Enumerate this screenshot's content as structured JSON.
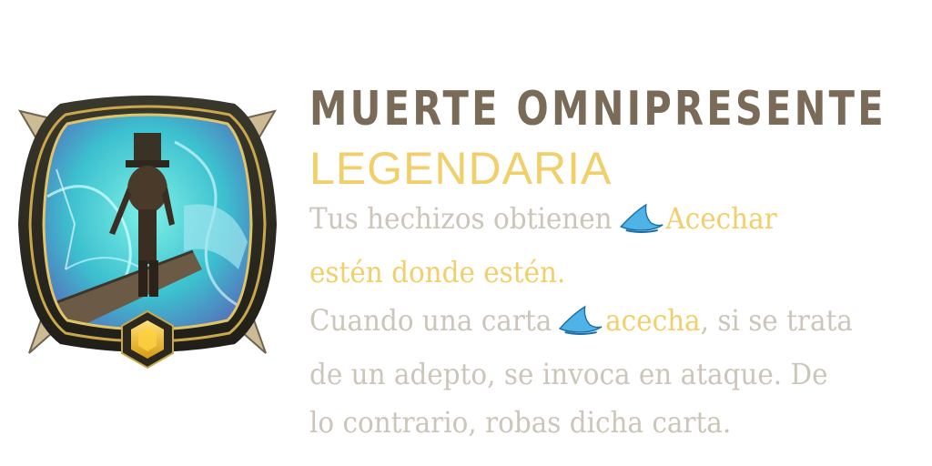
{
  "card": {
    "title": "MUERTE OMNIPRESENTE",
    "rarity": "LEGENDARIA",
    "description": {
      "line1_pre": "Tus hechizos obtienen",
      "line1_kw": "Acechar",
      "line2": "estén donde estén.",
      "line3_pre": "Cuando una carta",
      "line3_kw": "acecha",
      "line3_post": ", si se trata",
      "line4": "de un adepto, se invoca en ataque. De",
      "line5": "lo contrario, robas dicha carta."
    },
    "keyword_icon": "lurk-fin-icon",
    "rarity_gem_icon": "legendary-hexagon-gem-icon",
    "colors": {
      "title": "#7a6b58",
      "rarity": "#f1cf6a",
      "description": "#ccc5b9",
      "keyword": "#f1cf6a",
      "keyword_icon": "#4fb3e6",
      "frame": "#2c2b22",
      "frame_gold": "#c9a74a",
      "art_bg": "#4fd0d8"
    }
  }
}
